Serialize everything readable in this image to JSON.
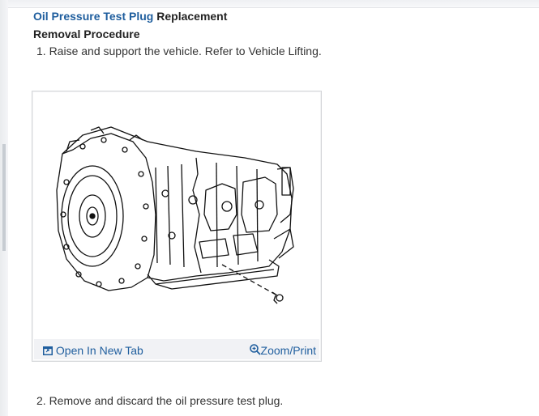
{
  "procedure": {
    "title_link": "Oil Pressure Test Plug",
    "title_rest": " Replacement",
    "subheading": "Removal Procedure",
    "steps": [
      "1. Raise and support the vehicle. Refer to Vehicle Lifting.",
      "2. Remove and discard the oil pressure test plug."
    ]
  },
  "figure": {
    "open_tab_label": "Open In New Tab",
    "zoom_label": "Zoom/Print",
    "icons": {
      "open_tab": "open-in-new-tab-icon",
      "zoom": "zoom-icon"
    }
  },
  "colors": {
    "link": "#1f5e9e",
    "text": "#222222",
    "figure_bar": "#f1f2f5"
  }
}
